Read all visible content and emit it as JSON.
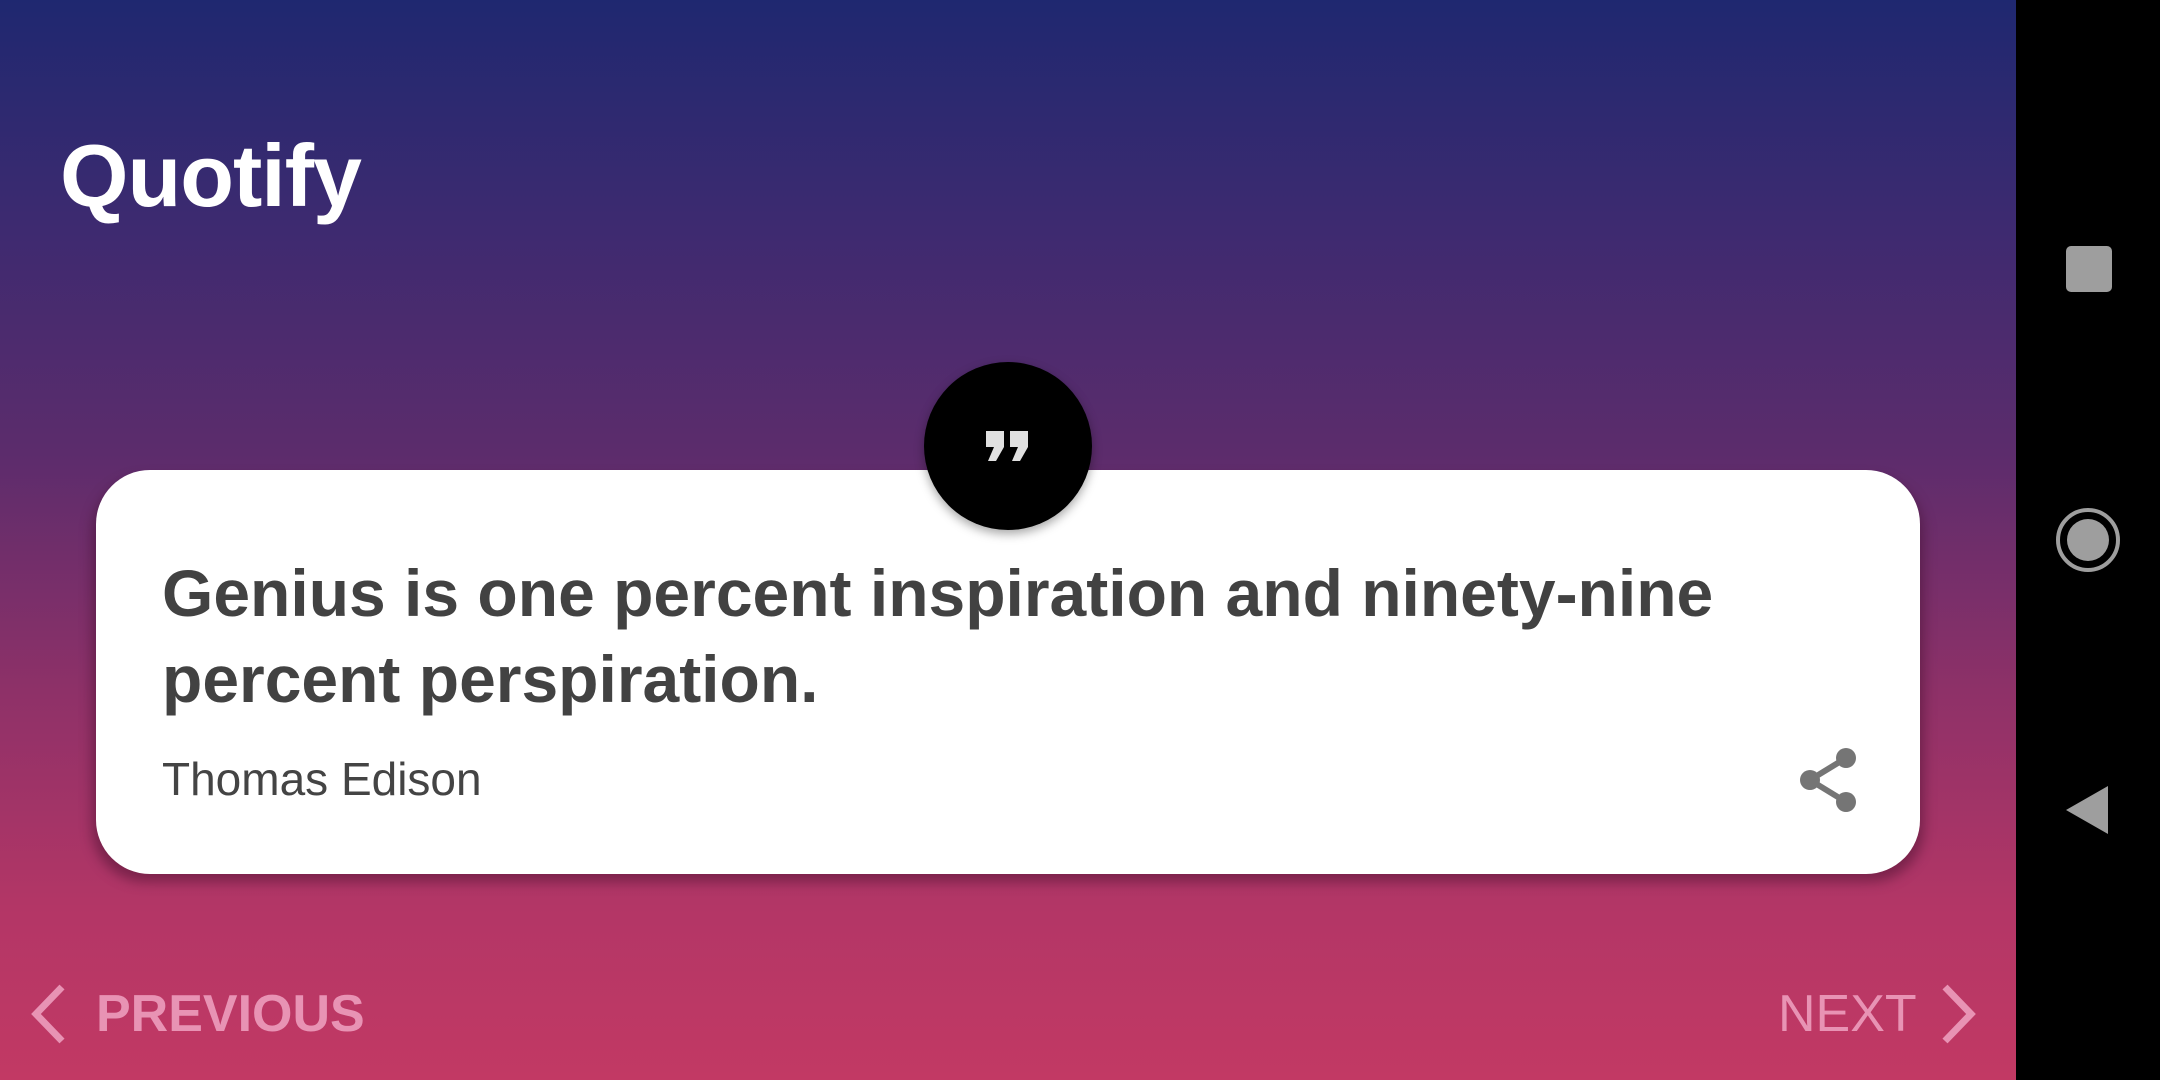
{
  "app": {
    "title": "Quotify"
  },
  "quote": {
    "text": "Genius is one percent inspiration and ninety-nine percent perspiration.",
    "author": "Thomas Edison",
    "badge_icon": "format-quote-icon",
    "share_icon": "share-icon"
  },
  "navigation": {
    "previous_label": "PREVIOUS",
    "next_label": "NEXT",
    "previous_icon": "chevron-left-icon",
    "next_icon": "chevron-right-icon"
  },
  "system_nav": {
    "recents_icon": "square-recents-icon",
    "home_icon": "circle-home-icon",
    "back_icon": "triangle-back-icon"
  },
  "colors": {
    "gradient_top": "#1f2870",
    "gradient_bottom": "#c23964",
    "card": "#ffffff",
    "quote_text": "#424242",
    "nav_label": "#e893b4",
    "badge": "#000000"
  }
}
